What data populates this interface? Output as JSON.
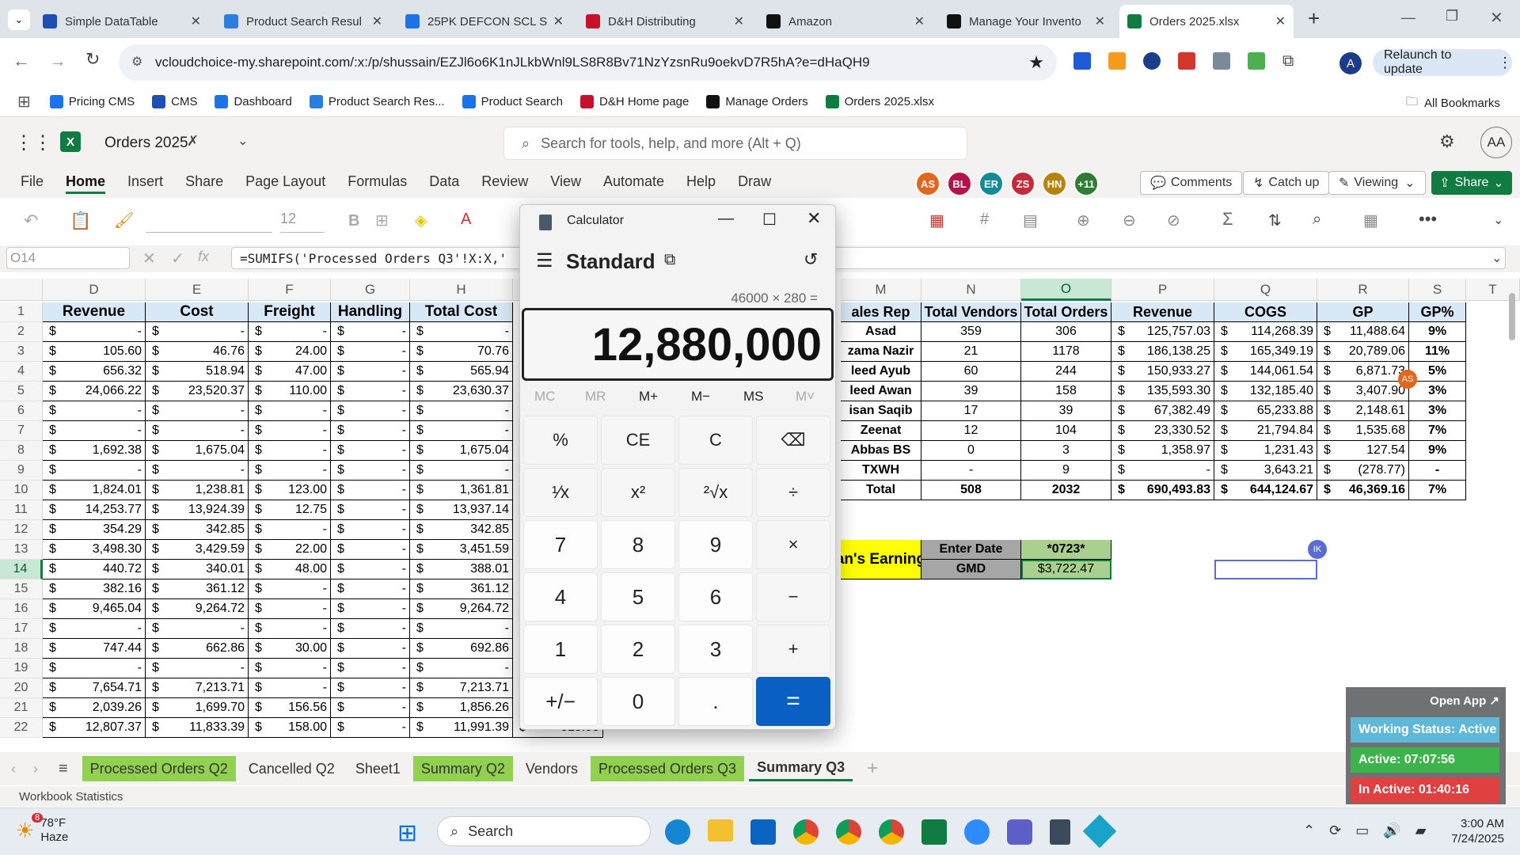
{
  "browser": {
    "tabs": [
      {
        "title": "Simple DataTable",
        "color": "#1e4fb3"
      },
      {
        "title": "Product Search Resul",
        "color": "#2a7de1"
      },
      {
        "title": "25PK DEFCON SCL S",
        "color": "#1a73e8"
      },
      {
        "title": "D&H Distributing",
        "color": "#c8102e"
      },
      {
        "title": "Amazon",
        "color": "#111"
      },
      {
        "title": "Manage Your Invento",
        "color": "#111"
      },
      {
        "title": "Orders 2025.xlsx",
        "color": "#107c41"
      }
    ],
    "url": "vcloudchoice-my.sharepoint.com/:x:/p/shussain/EZJl6o6K1nJLkbWnl9LS8R8Bv71NzYzsnRu9oekvD7R5hA?e=dHaQH9",
    "relaunch": "Relaunch to update",
    "profile_initial": "A",
    "bookmarks": [
      {
        "label": "Pricing CMS",
        "color": "#1a73e8"
      },
      {
        "label": "CMS",
        "color": "#1e4fb3"
      },
      {
        "label": "Dashboard",
        "color": "#1a73e8"
      },
      {
        "label": "Product Search Res...",
        "color": "#2a7de1"
      },
      {
        "label": "Product Search",
        "color": "#1a73e8"
      },
      {
        "label": "D&H Home page",
        "color": "#c8102e"
      },
      {
        "label": "Manage Orders",
        "color": "#111"
      },
      {
        "label": "Orders 2025.xlsx",
        "color": "#107c41"
      }
    ],
    "all_bookmarks": "All Bookmarks"
  },
  "excel": {
    "doc_title": "Orders 2025",
    "search_placeholder": "Search for tools, help, and more (Alt + Q)",
    "user_initials": "AA",
    "ribbon_tabs": [
      "File",
      "Home",
      "Insert",
      "Share",
      "Page Layout",
      "Formulas",
      "Data",
      "Review",
      "View",
      "Automate",
      "Help",
      "Draw"
    ],
    "avatars": [
      {
        "txt": "AS",
        "color": "#e2661b"
      },
      {
        "txt": "BL",
        "color": "#b3124a"
      },
      {
        "txt": "ER",
        "color": "#138a97"
      },
      {
        "txt": "ZS",
        "color": "#c42b3c"
      },
      {
        "txt": "HN",
        "color": "#b6830e"
      },
      {
        "txt": "+11",
        "color": "#2e7d32"
      }
    ],
    "comments": "Comments",
    "catchup": "Catch up",
    "viewing": "Viewing",
    "share": "Share",
    "font_size": "12",
    "namebox": "O14",
    "formula": "=SUMIFS('Processed Orders Q3'!X:X,'"
  },
  "left_table": {
    "headers": [
      "Revenue",
      "Cost",
      "Freight",
      "Handling",
      "Total Cost"
    ],
    "columns": [
      "D",
      "E",
      "F",
      "G",
      "H"
    ],
    "rows": [
      [
        "-",
        "-",
        "-",
        "-",
        "-"
      ],
      [
        "105.60",
        "46.76",
        "24.00",
        "-",
        "70.76"
      ],
      [
        "656.32",
        "518.94",
        "47.00",
        "-",
        "565.94"
      ],
      [
        "24,066.22",
        "23,520.37",
        "110.00",
        "-",
        "23,630.37"
      ],
      [
        "-",
        "-",
        "-",
        "-",
        "-"
      ],
      [
        "-",
        "-",
        "-",
        "-",
        "-"
      ],
      [
        "1,692.38",
        "1,675.04",
        "-",
        "-",
        "1,675.04"
      ],
      [
        "-",
        "-",
        "-",
        "-",
        "-"
      ],
      [
        "1,824.01",
        "1,238.81",
        "123.00",
        "-",
        "1,361.81"
      ],
      [
        "14,253.77",
        "13,924.39",
        "12.75",
        "-",
        "13,937.14"
      ],
      [
        "354.29",
        "342.85",
        "-",
        "-",
        "342.85"
      ],
      [
        "3,498.30",
        "3,429.59",
        "22.00",
        "-",
        "3,451.59"
      ],
      [
        "440.72",
        "340.01",
        "48.00",
        "-",
        "388.01"
      ],
      [
        "382.16",
        "361.12",
        "-",
        "-",
        "361.12"
      ],
      [
        "9,465.04",
        "9,264.72",
        "-",
        "-",
        "9,264.72"
      ],
      [
        "-",
        "-",
        "-",
        "-",
        "-"
      ],
      [
        "747.44",
        "662.86",
        "30.00",
        "-",
        "692.86"
      ],
      [
        "-",
        "-",
        "-",
        "-",
        "-"
      ],
      [
        "7,654.71",
        "7,213.71",
        "-",
        "-",
        "7,213.71"
      ],
      [
        "2,039.26",
        "1,699.70",
        "156.56",
        "-",
        "1,856.26"
      ],
      [
        "12,807.37",
        "11,833.39",
        "158.00",
        "-",
        "11,991.39"
      ]
    ],
    "partial_value": "815.98"
  },
  "right_table": {
    "headers": [
      "ales Rep",
      "Total Vendors",
      "Total Orders",
      "Revenue",
      "COGS",
      "GP",
      "GP%"
    ],
    "columns": [
      "M",
      "N",
      "O",
      "P",
      "Q",
      "R",
      "S",
      "T"
    ],
    "rows": [
      [
        "Asad",
        "359",
        "306",
        "125,757.03",
        "114,268.39",
        "11,488.64",
        "9%"
      ],
      [
        "zama Nazir",
        "21",
        "1178",
        "186,138.25",
        "165,349.19",
        "20,789.06",
        "11%"
      ],
      [
        "leed Ayub",
        "60",
        "244",
        "150,933.27",
        "144,061.54",
        "6,871.73",
        "5%"
      ],
      [
        "leed Awan",
        "39",
        "158",
        "135,593.30",
        "132,185.40",
        "3,407.90",
        "3%"
      ],
      [
        "isan Saqib",
        "17",
        "39",
        "67,382.49",
        "65,233.88",
        "2,148.61",
        "3%"
      ],
      [
        "Zeenat",
        "12",
        "104",
        "23,330.52",
        "21,794.84",
        "1,535.68",
        "7%"
      ],
      [
        "Abbas BS",
        "0",
        "3",
        "1,358.97",
        "1,231.43",
        "127.54",
        "9%"
      ],
      [
        "TXWH",
        "-",
        "9",
        "-",
        "3,643.21",
        "(278.77)",
        "-"
      ],
      [
        "Total",
        "508",
        "2032",
        "690,493.83",
        "644,124.67",
        "46,369.16",
        "7%"
      ]
    ],
    "earning_label": "an's Earning",
    "enter_date_label": "Enter Date",
    "enter_date_value": "*0723*",
    "gmd_label": "GMD",
    "gmd_value": "$3,722.47",
    "presence_as": "AS",
    "presence_ik": "IK"
  },
  "row_numbers": [
    "1",
    "2",
    "3",
    "4",
    "5",
    "6",
    "7",
    "8",
    "9",
    "10",
    "11",
    "12",
    "13",
    "14",
    "15",
    "16",
    "17",
    "18",
    "19",
    "20",
    "21",
    "22"
  ],
  "currency_symbol": "$",
  "calculator": {
    "app_title": "Calculator",
    "mode": "Standard",
    "expression": "46000 × 280 =",
    "display": "12,880,000",
    "memory": [
      "MC",
      "MR",
      "M+",
      "M−",
      "MS",
      "M˅"
    ],
    "buttons": [
      [
        "%",
        "CE",
        "C",
        "⌫"
      ],
      [
        "¹⁄x",
        "x²",
        "²√x",
        "÷"
      ],
      [
        "7",
        "8",
        "9",
        "×"
      ],
      [
        "4",
        "5",
        "6",
        "−"
      ],
      [
        "1",
        "2",
        "3",
        "+"
      ],
      [
        "+/−",
        "0",
        ".",
        "="
      ]
    ]
  },
  "sheets": [
    "Processed Orders Q2",
    "Cancelled Q2",
    "Sheet1",
    "Summary Q2",
    "Vendors",
    "Processed Orders Q3",
    "Summary Q3"
  ],
  "status": {
    "left": "Workbook Statistics"
  },
  "widget": {
    "open_app": "Open App ↗",
    "working": "Working Status: Active",
    "active": "Active: 07:07:56",
    "inactive": "In Active: 01:40:16"
  },
  "taskbar": {
    "weather_temp": "78°F",
    "weather_desc": "Haze",
    "weather_badge": "8",
    "search": "Search",
    "time": "3:00 AM",
    "date": "7/24/2025"
  }
}
